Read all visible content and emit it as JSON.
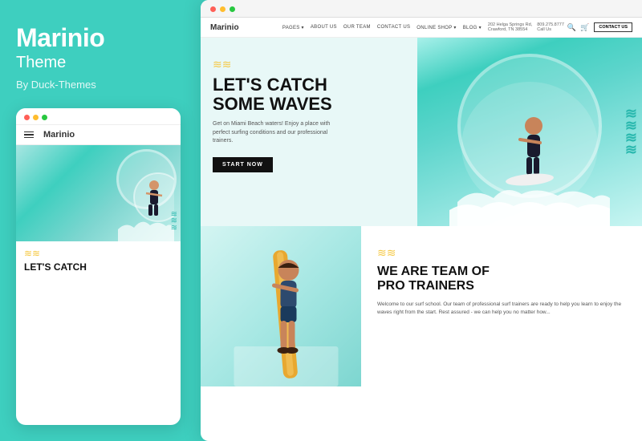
{
  "left": {
    "title": "Marinio",
    "subtitle": "Theme",
    "author": "By Duck-Themes",
    "mobile_preview": {
      "logo": "Marinio",
      "headline_line1": "LET'S CATCH"
    }
  },
  "browser": {
    "dots": [
      "red",
      "yellow",
      "green"
    ]
  },
  "site": {
    "logo": "Marinio",
    "nav_links": [
      "PAGES ▾",
      "ABOUT US",
      "OUR TEAM",
      "CONTACT US",
      "ONLINE SHOP ▾",
      "BLOG ▾"
    ],
    "address_line1": "202 Helga Springs Rd,",
    "address_line2": "Crawford, TN 38554",
    "phone": "809.275.8777",
    "phone_label": "Call Us",
    "contact_btn": "CONTACT US"
  },
  "hero": {
    "headline_line1": "LET'S CATCH",
    "headline_line2": "SOME WAVES",
    "subtext": "Get on Miami Beach waters! Enjoy a place with perfect surfing conditions and our professional trainers.",
    "cta": "START NOW"
  },
  "team_section": {
    "headline_line1": "WE ARE TEAM OF",
    "headline_line2": "PRO TRAINERS",
    "body": "Welcome to our surf school. Our team of professional surf trainers are ready to help you learn to enjoy the waves right from the start. Rest assured - we can help you no matter how..."
  }
}
